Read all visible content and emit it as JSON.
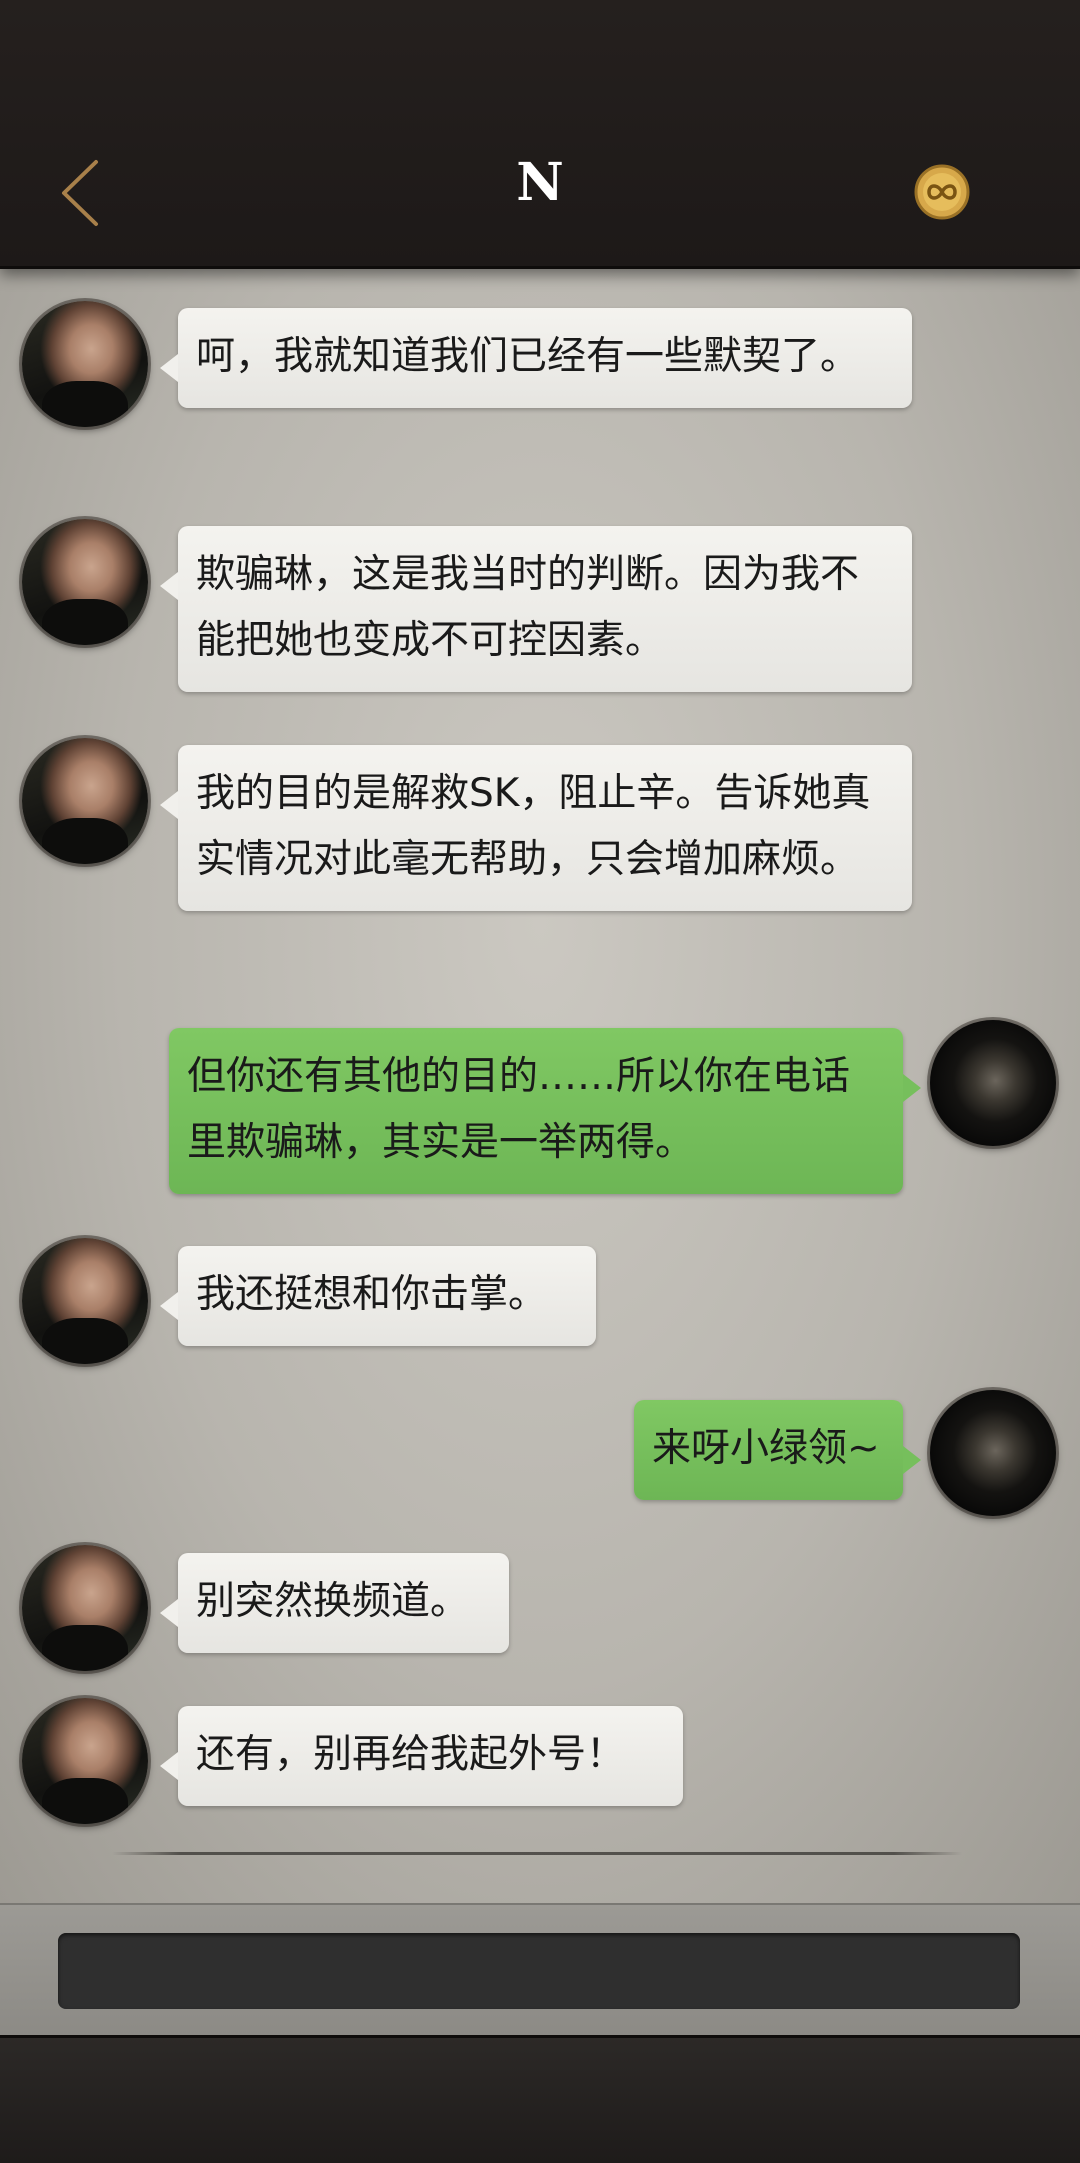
{
  "header": {
    "title": "N",
    "back_icon": "chevron-left-icon",
    "badge_icon": "infinity-badge-icon",
    "accent": "#a8804a",
    "badge_color": "#d7a84a"
  },
  "colors": {
    "outgoing_bubble": "#76bf5c",
    "incoming_bubble": "#f1f0ec"
  },
  "messages": [
    {
      "sender": "N",
      "text": "呵，我就知道我们已经有一些默契了。"
    },
    {
      "sender": "N",
      "text": "欺骗琳，这是我当时的判断。因为我不能把她也变成不可控因素。"
    },
    {
      "sender": "N",
      "text": "我的目的是解救SK，阻止辛。告诉她真实情况对此毫无帮助，只会增加麻烦。"
    },
    {
      "sender": "me",
      "text": "但你还有其他的目的……所以你在电话里欺骗琳，其实是一举两得。"
    },
    {
      "sender": "N",
      "text": "我还挺想和你击掌。"
    },
    {
      "sender": "me",
      "text": "来呀小绿领~"
    },
    {
      "sender": "N",
      "text": "别突然换频道。"
    },
    {
      "sender": "N",
      "text": "还有，别再给我起外号！"
    }
  ],
  "input": {
    "value": ""
  }
}
